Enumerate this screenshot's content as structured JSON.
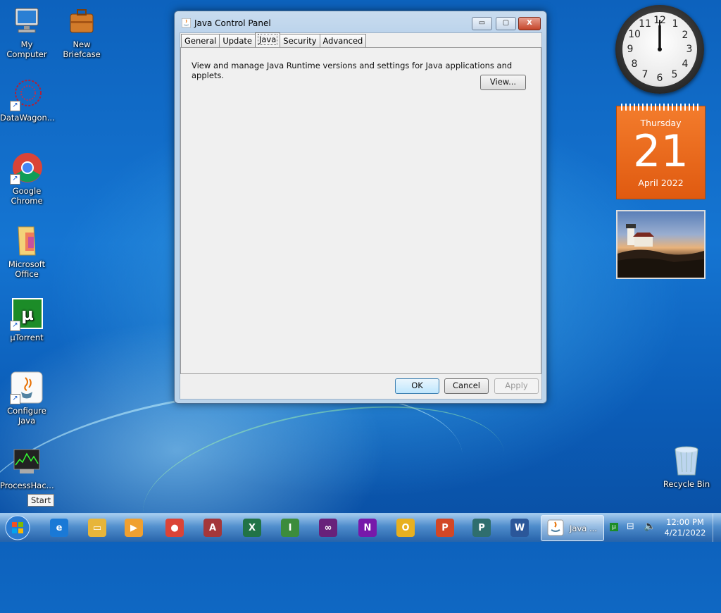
{
  "desktop": {
    "icons": [
      {
        "label": "My Computer",
        "icon": "computer-icon"
      },
      {
        "label": "New Briefcase",
        "icon": "briefcase-icon"
      },
      {
        "label": "DataWagon...",
        "icon": "datawagon-icon"
      },
      {
        "label": "Google Chrome",
        "icon": "chrome-icon"
      },
      {
        "label": "Microsoft Office",
        "icon": "folder-icon"
      },
      {
        "label": "µTorrent",
        "icon": "utorrent-icon"
      },
      {
        "label": "Configure Java",
        "icon": "java-icon"
      },
      {
        "label": "ProcessHac...",
        "icon": "processhacker-icon"
      },
      {
        "label": "Recycle Bin",
        "icon": "recycle-bin-icon"
      }
    ]
  },
  "window": {
    "title": "Java Control Panel",
    "tabs": [
      "General",
      "Update",
      "Java",
      "Security",
      "Advanced"
    ],
    "active_tab": "Java",
    "description": "View and manage Java Runtime versions and settings for Java applications and applets.",
    "view_button": "View...",
    "ok_button": "OK",
    "cancel_button": "Cancel",
    "apply_button": "Apply",
    "controls": {
      "minimize": "▭",
      "maximize": "▢",
      "close": "X"
    }
  },
  "gadgets": {
    "clock": {
      "numbers": [
        "12",
        "1",
        "2",
        "3",
        "4",
        "5",
        "6",
        "7",
        "8",
        "9",
        "10",
        "11"
      ]
    },
    "calendar": {
      "weekday": "Thursday",
      "day": "21",
      "month_year": "April 2022"
    }
  },
  "taskbar": {
    "start_tooltip": "Start",
    "active_app_label": "Java ...",
    "time": "12:00 PM",
    "date": "4/21/2022",
    "pinned": [
      {
        "icon": "ie-icon",
        "color": "#1a79d6"
      },
      {
        "icon": "explorer-icon",
        "color": "#e7b53a"
      },
      {
        "icon": "media-player-icon",
        "color": "#f0a030"
      },
      {
        "icon": "chrome-icon",
        "color": "#db4437"
      },
      {
        "icon": "access-icon",
        "color": "#a4373a"
      },
      {
        "icon": "excel-icon",
        "color": "#217346"
      },
      {
        "icon": "infopath-icon",
        "color": "#3c8c3c"
      },
      {
        "icon": "visual-studio-icon",
        "color": "#68217a"
      },
      {
        "icon": "onenote-icon",
        "color": "#7719aa"
      },
      {
        "icon": "outlook-icon",
        "color": "#e8b020"
      },
      {
        "icon": "powerpoint-icon",
        "color": "#d24726"
      },
      {
        "icon": "publisher-icon",
        "color": "#2f6e6e"
      },
      {
        "icon": "word-icon",
        "color": "#2b579a"
      }
    ]
  }
}
